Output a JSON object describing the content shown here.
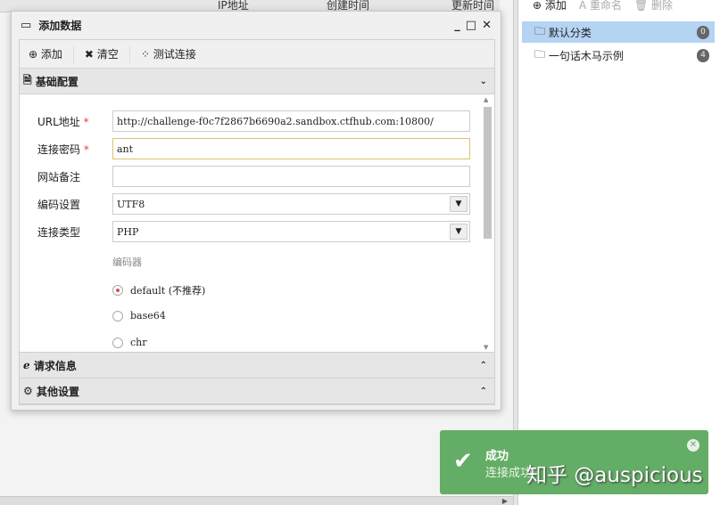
{
  "background_table": {
    "headers": [
      "IP地址",
      "创建时间",
      "更新时间"
    ]
  },
  "dialog": {
    "title": "添加数据",
    "controls": {
      "minimize": "_",
      "maximize": "□",
      "close": "✕"
    },
    "toolbar": {
      "add": "添加",
      "clear": "清空",
      "test": "测试连接"
    },
    "sections": {
      "basic": "基础配置",
      "request": "请求信息",
      "other": "其他设置"
    },
    "form": {
      "url_label": "URL地址",
      "url_value": "http://challenge-f0c7f2867b6690a2.sandbox.ctfhub.com:10800/",
      "pwd_label": "连接密码",
      "pwd_value": "ant",
      "note_label": "网站备注",
      "note_value": "",
      "encoding_label": "编码设置",
      "encoding_value": "UTF8",
      "type_label": "连接类型",
      "type_value": "PHP",
      "required_mark": "*",
      "encoder_label": "编码器",
      "encoders": [
        "default (不推荐)",
        "base64",
        "chr"
      ],
      "encoder_selected": "default (不推荐)"
    }
  },
  "right_panel": {
    "toolbar": {
      "add": "添加",
      "rename": "重命名",
      "delete": "删除"
    },
    "categories": [
      {
        "label": "默认分类",
        "count": "0",
        "selected": true
      },
      {
        "label": "一句话木马示例",
        "count": "4",
        "selected": false
      }
    ]
  },
  "toast": {
    "title": "成功",
    "message": "连接成功!",
    "color": "#64ad66"
  },
  "watermark": "知乎 @auspicious"
}
